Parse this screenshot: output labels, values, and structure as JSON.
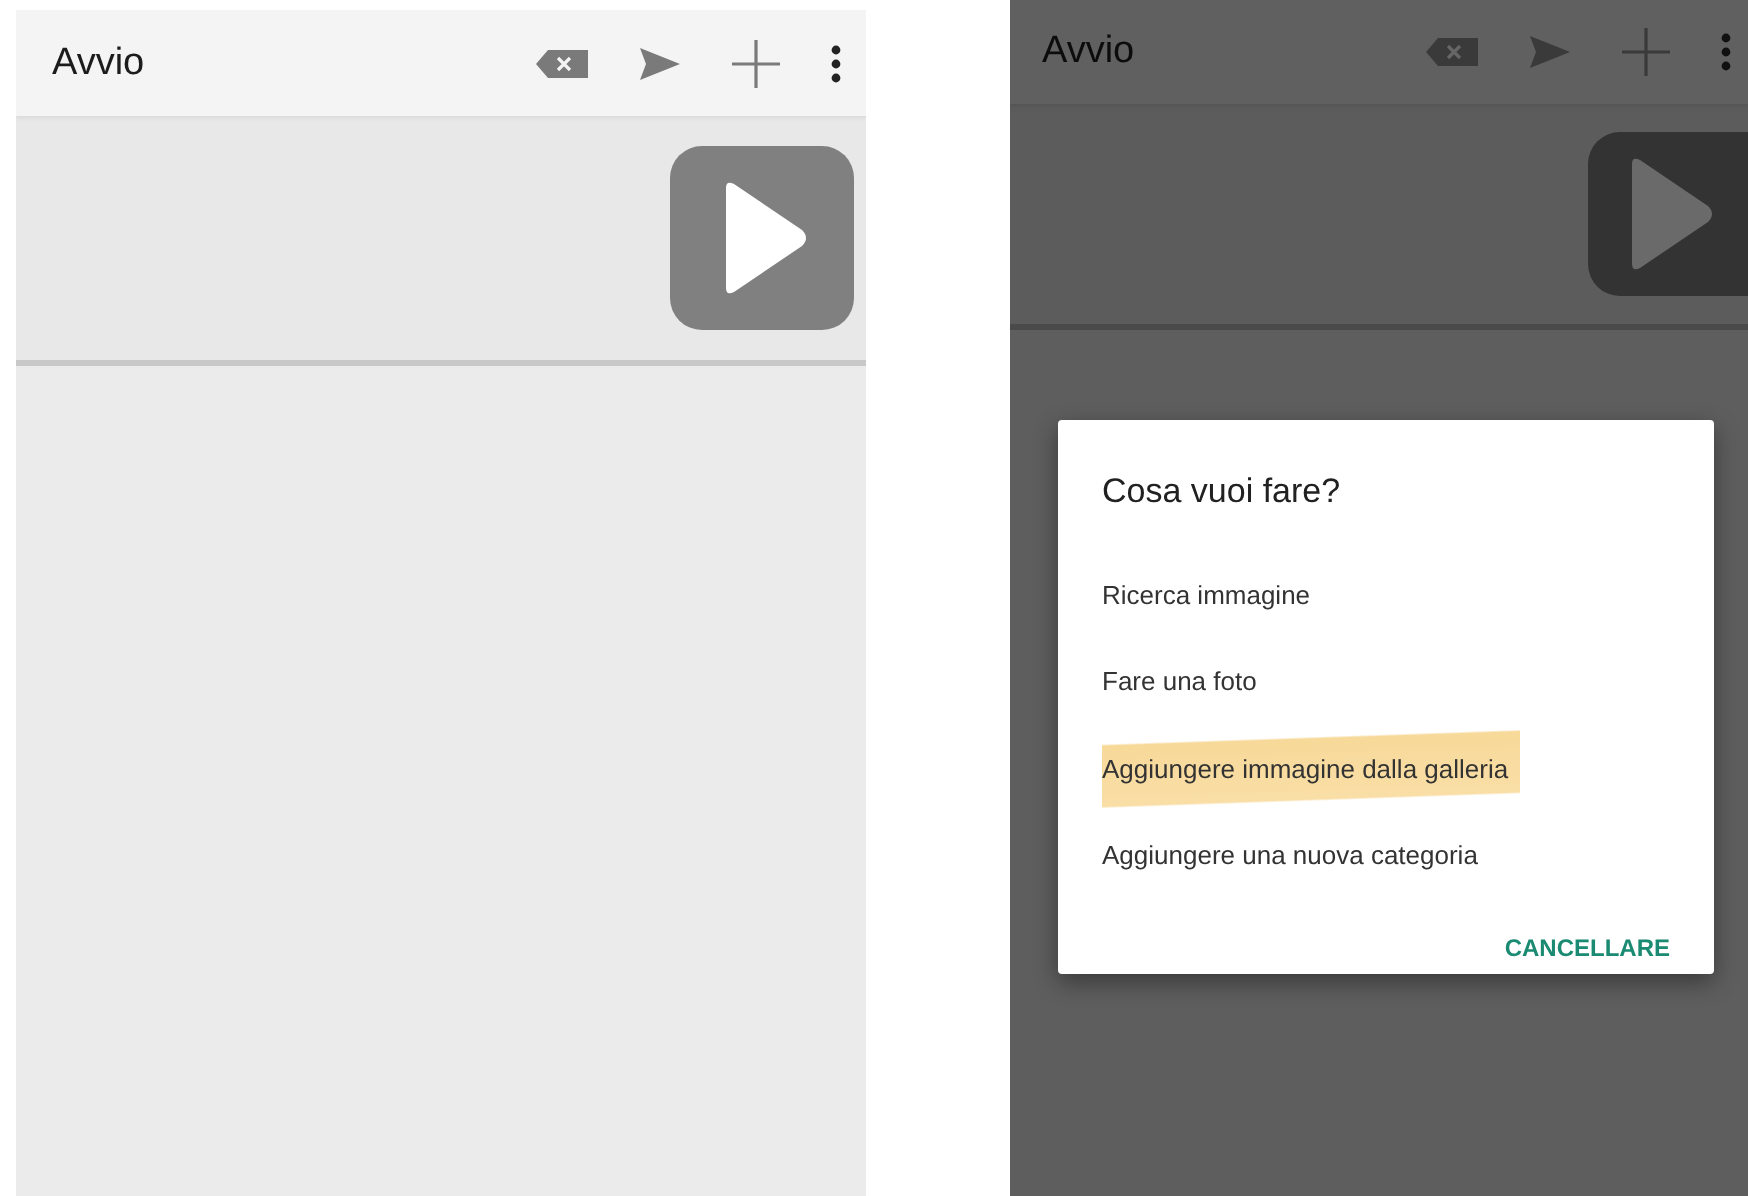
{
  "screens": [
    {
      "title": "Avvio",
      "dimmed": false
    },
    {
      "title": "Avvio",
      "dimmed": true,
      "dialog": {
        "title": "Cosa vuoi fare?",
        "options": [
          {
            "label": "Ricerca immagine",
            "highlighted": false
          },
          {
            "label": "Fare una foto",
            "highlighted": false
          },
          {
            "label": "Aggiungere immagine dalla galleria",
            "highlighted": true
          },
          {
            "label": "Aggiungere una nuova categoria",
            "highlighted": false
          }
        ],
        "action": "CANCELLARE"
      }
    }
  ]
}
